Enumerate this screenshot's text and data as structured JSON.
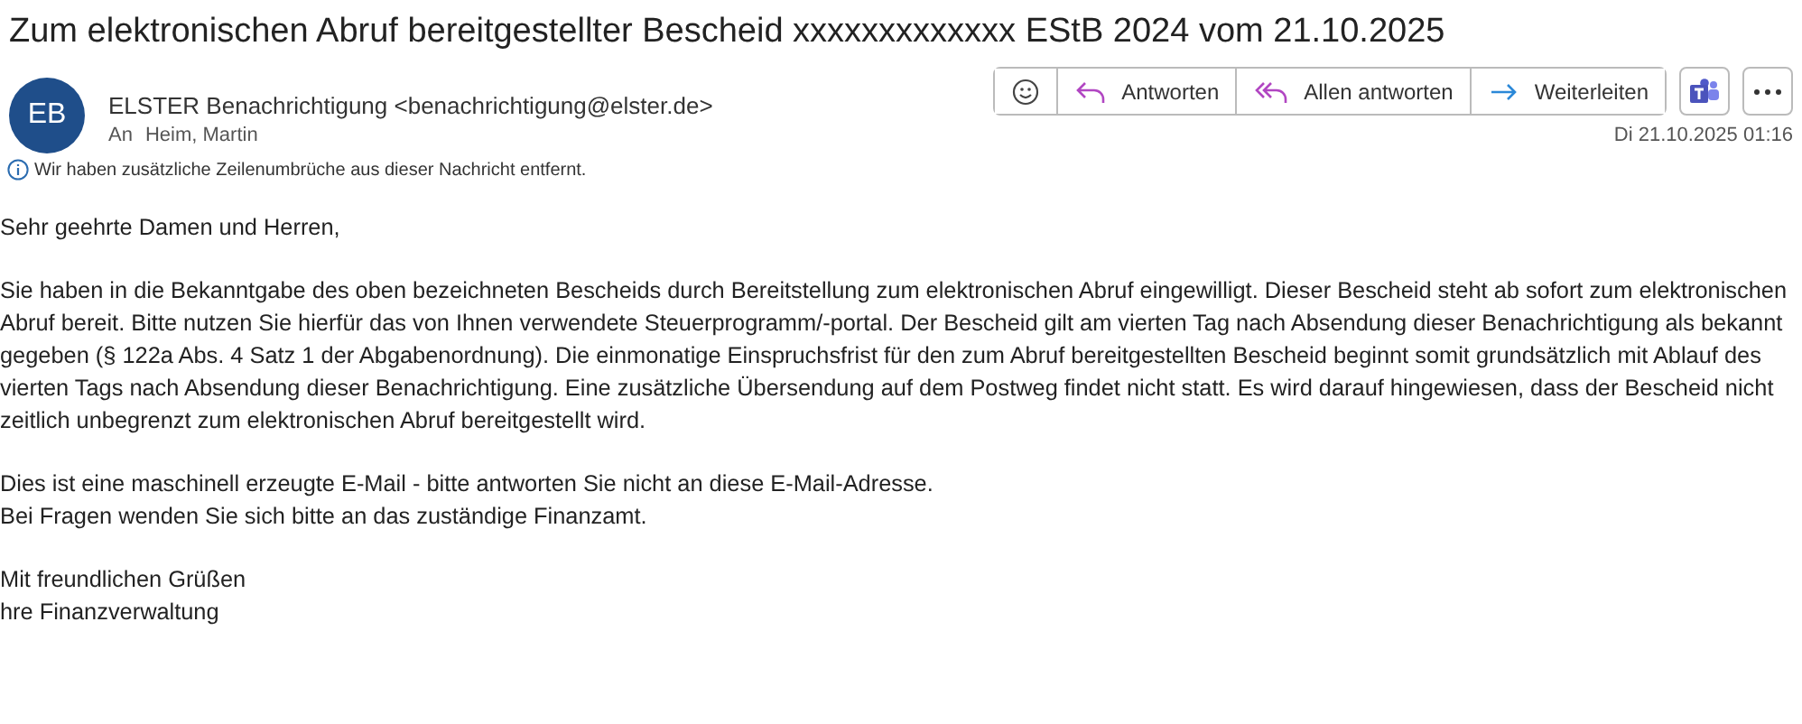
{
  "subject": "Zum elektronischen Abruf bereitgestellter Bescheid xxxxxxxxxxxxx EStB 2024 vom 21.10.2025",
  "sender": {
    "initials": "EB",
    "name": "ELSTER Benachrichtigung <benachrichtigung@elster.de>",
    "to_label": "An",
    "to": "Heim, Martin",
    "date": "Di 21.10.2025 01:16"
  },
  "actions": [
    {
      "kind": "emoji"
    },
    {
      "kind": "reply",
      "label": "Antworten"
    },
    {
      "kind": "reply_all",
      "label": "Allen antworten"
    },
    {
      "kind": "forward",
      "label": "Weiterleiten"
    }
  ],
  "extra_buttons": [
    {
      "kind": "teams"
    },
    {
      "kind": "more"
    }
  ],
  "notice": "Wir haben zusätzliche Zeilenumbrüche aus dieser Nachricht entfernt.",
  "body": [
    [
      "Sehr geehrte Damen und Herren,"
    ],
    [
      "Sie haben in die Bekanntgabe des oben bezeichneten Bescheids durch Bereitstellung zum elektronischen Abruf eingewilligt. Dieser Bescheid steht ab sofort zum elektronischen Abruf bereit. Bitte nutzen Sie hierfür das von Ihnen verwendete Steuerprogramm/-portal. Der Bescheid gilt am vierten Tag nach Absendung dieser Benachrichtigung als bekannt gegeben (§ 122a Abs. 4 Satz 1 der Abgabenordnung). Die einmonatige Einspruchsfrist für den zum Abruf bereitgestellten Bescheid beginnt somit grundsätzlich mit Ablauf des vierten Tags nach Absendung dieser Benachrichtigung. Eine zusätzliche Übersendung auf dem Postweg findet nicht statt. Es wird darauf hingewiesen, dass der Bescheid nicht zeitlich unbegrenzt zum elektronischen Abruf bereitgestellt wird."
    ],
    [
      "Dies ist eine maschinell erzeugte E-Mail - bitte antworten Sie nicht an diese E-Mail-Adresse.",
      "Bei Fragen wenden Sie sich bitte an das zuständige Finanzamt."
    ],
    [
      "Mit freundlichen Grüßen",
      "hre Finanzverwaltung"
    ]
  ]
}
